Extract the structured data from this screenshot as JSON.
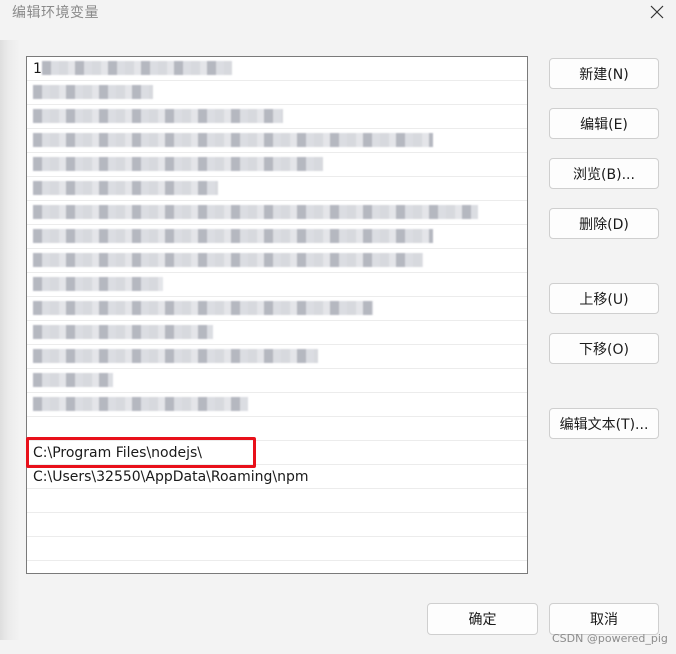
{
  "window": {
    "title": "编辑环境变量"
  },
  "paths": [
    {
      "text": "1",
      "blur": 190,
      "light": false
    },
    {
      "text": "",
      "blur": 120,
      "light": false
    },
    {
      "text": "",
      "blur": 250,
      "light": false
    },
    {
      "text": "",
      "blur": 400,
      "light": false
    },
    {
      "text": "",
      "blur": 290,
      "light": false
    },
    {
      "text": "",
      "blur": 185,
      "light": false
    },
    {
      "text": "",
      "blur": 445,
      "light": false
    },
    {
      "text": "",
      "blur": 400,
      "light": false
    },
    {
      "text": "",
      "blur": 390,
      "light": false
    },
    {
      "text": "",
      "blur": 130,
      "light": false
    },
    {
      "text": "",
      "blur": 340,
      "light": false
    },
    {
      "text": "",
      "blur": 180,
      "light": false
    },
    {
      "text": "",
      "blur": 285,
      "light": false
    },
    {
      "text": "",
      "blur": 80,
      "light": false
    },
    {
      "text": "",
      "blur": 215,
      "light": false
    },
    {
      "text": "",
      "blur": 0,
      "light": false
    },
    {
      "text": "C:\\Program Files\\nodejs\\",
      "blur": 0,
      "light": false
    },
    {
      "text": "C:\\Users\\32550\\AppData\\Roaming\\npm",
      "blur": 0,
      "light": false
    },
    {
      "text": "",
      "blur": 0,
      "light": false
    },
    {
      "text": "",
      "blur": 0,
      "light": false
    },
    {
      "text": "",
      "blur": 0,
      "light": false
    }
  ],
  "buttons": {
    "new": "新建(N)",
    "edit": "编辑(E)",
    "browse": "浏览(B)...",
    "delete": "删除(D)",
    "move_up": "上移(U)",
    "move_down": "下移(O)",
    "edit_text": "编辑文本(T)...",
    "ok": "确定",
    "cancel": "取消"
  },
  "watermark": "CSDN @powered_pig"
}
